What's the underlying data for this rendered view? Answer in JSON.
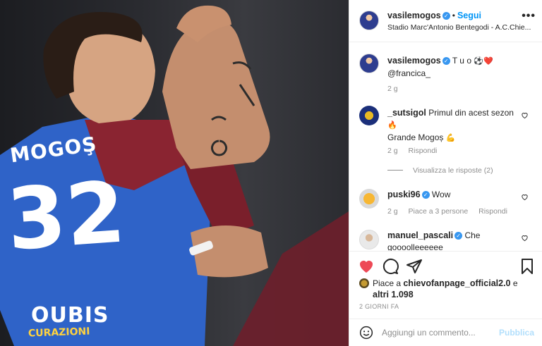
{
  "photo": {
    "jersey_name": "MOGOŞ",
    "jersey_number": "32",
    "sponsor": "OUBIS",
    "sponsor_sub": "CURAZIONI"
  },
  "post_header": {
    "username": "vasilemogos",
    "separator": "•",
    "follow_label": "Segui",
    "location": "Stadio Marc'Antonio Bentegodi - A.C.Chie...",
    "more_label": "•••"
  },
  "caption": {
    "username": "vasilemogos",
    "text": "T u o",
    "emoji_ball": "⚽",
    "emoji_heart": "❤️",
    "mention": "@francica_",
    "age": "2 g"
  },
  "comments": [
    {
      "username": "_sutsigol",
      "line1": "Primul din acest sezon",
      "emoji1": "🔥",
      "line2": "Grande Mogoș",
      "emoji2": "💪",
      "age": "2 g",
      "reply_label": "Rispondi",
      "view_replies": "Visualizza le risposte (2)"
    },
    {
      "username": "puski96",
      "text": "Wow",
      "age": "2 g",
      "likes_label": "Piace a 3 persone",
      "reply_label": "Rispondi"
    },
    {
      "username": "manuel_pascali",
      "text": "Che",
      "text2": "goooolleeeeee"
    }
  ],
  "likes": {
    "prefix": "Piace a ",
    "user": "chievofanpage_official2.0",
    "suffix": " e",
    "others": "altri 1.098"
  },
  "date": "2 GIORNI FA",
  "compose": {
    "placeholder": "Aggiungi un commento...",
    "publish_label": "Pubblica"
  },
  "icons": {
    "like": "heart-icon",
    "comment": "comment-icon",
    "share": "share-icon",
    "save": "bookmark-icon",
    "emoji": "smile-icon"
  },
  "colors": {
    "accent": "#0095f6",
    "like_red": "#ed4956",
    "verified": "#3897f0",
    "muted": "#8e8e8e"
  }
}
